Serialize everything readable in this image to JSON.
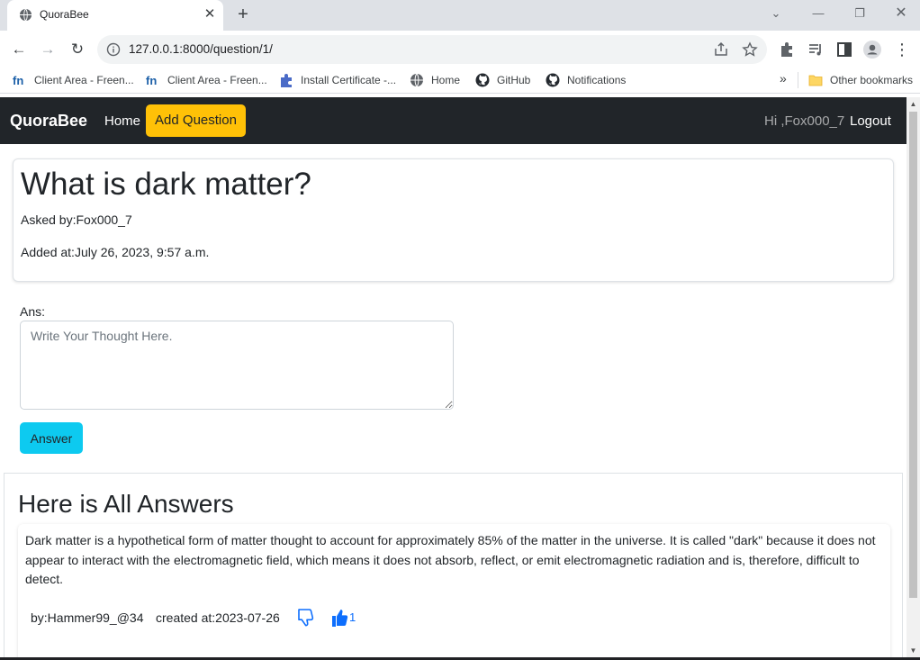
{
  "browser": {
    "tab_title": "QuoraBee",
    "url": "127.0.0.1:8000/question/1/",
    "bookmarks": [
      {
        "label": "Client Area - Freen...",
        "icon": "freenom-icon"
      },
      {
        "label": "Client Area - Freen...",
        "icon": "freenom-icon"
      },
      {
        "label": "Install Certificate -...",
        "icon": "puzzle-icon"
      },
      {
        "label": "Home",
        "icon": "globe-icon"
      },
      {
        "label": "GitHub",
        "icon": "github-icon"
      },
      {
        "label": "Notifications",
        "icon": "github-icon"
      }
    ],
    "other_bookmarks": "Other bookmarks",
    "overflow": "»"
  },
  "navbar": {
    "brand": "QuoraBee",
    "home": "Home",
    "add_question": "Add Question",
    "greeting": "Hi ,Fox000_7",
    "logout": "Logout"
  },
  "question": {
    "title": "What is dark matter?",
    "asked_by": "Asked by:Fox000_7",
    "added_at": "Added at:July 26, 2023, 9:57 a.m."
  },
  "answer_form": {
    "label": "Ans:",
    "placeholder": "Write Your Thought Here.",
    "button": "Answer"
  },
  "answers": {
    "heading": "Here is All Answers",
    "items": [
      {
        "text": "Dark matter is a hypothetical form of matter thought to account for approximately 85% of the matter in the universe. It is called \"dark\" because it does not appear to interact with the electromagnetic field, which means it does not absorb, reflect, or emit electromagnetic radiation and is, therefore, difficult to detect.",
        "by": "by:Hammer99_@34",
        "created": "created at:2023-07-26",
        "likes": "1"
      }
    ]
  },
  "colors": {
    "navbar_bg": "#212529",
    "add_button": "#ffc107",
    "answer_button": "#0dcaf0",
    "like_blue": "#0d6efd"
  }
}
